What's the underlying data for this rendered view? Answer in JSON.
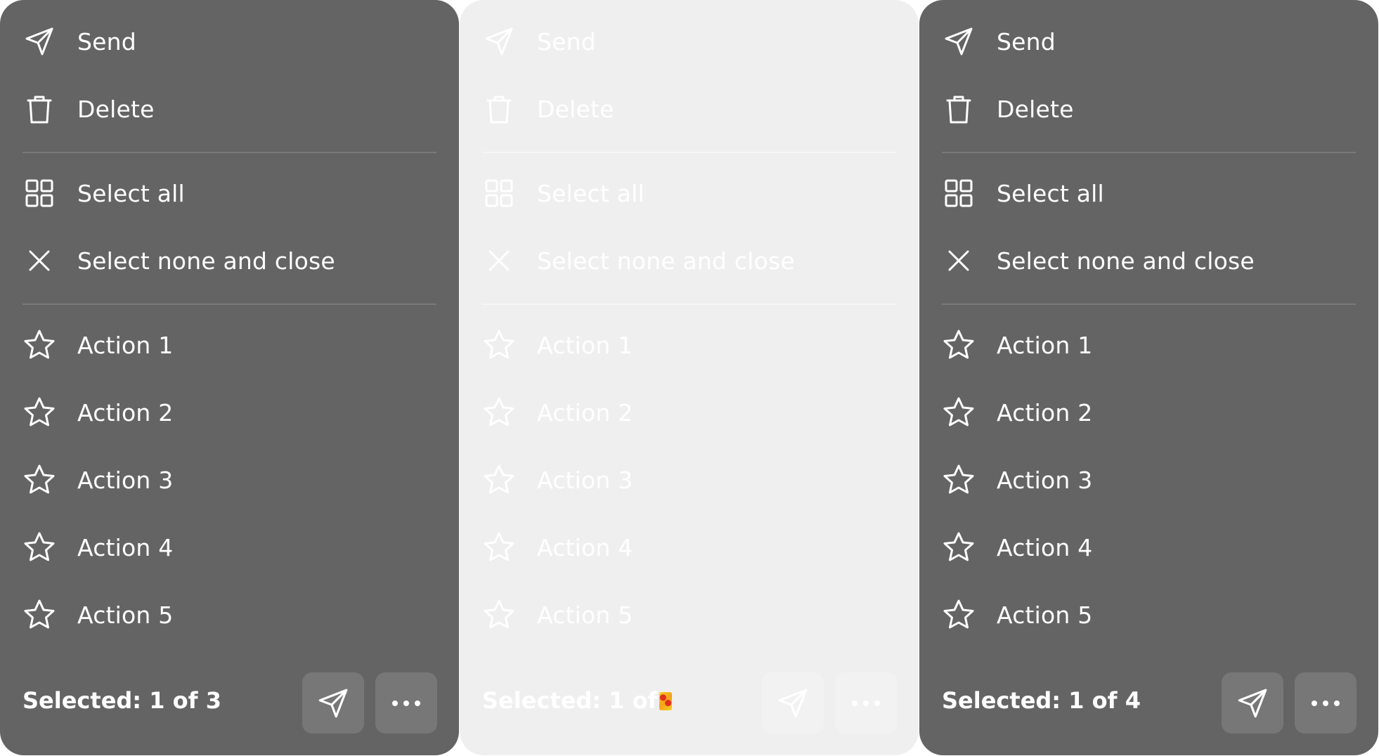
{
  "panels": [
    {
      "theme": "dark",
      "menu": {
        "send": "Send",
        "delete": "Delete",
        "select_all": "Select all",
        "select_none": "Select none and close",
        "actions": [
          "Action 1",
          "Action 2",
          "Action 3",
          "Action 4",
          "Action 5"
        ]
      },
      "footer": {
        "selected": "Selected: 1 of 3"
      }
    },
    {
      "theme": "light",
      "menu": {
        "send": "Send",
        "delete": "Delete",
        "select_all": "Select all",
        "select_none": "Select none and close",
        "actions": [
          "Action 1",
          "Action 2",
          "Action 3",
          "Action 4",
          "Action 5"
        ]
      },
      "footer": {
        "selected": "Selected: 1 of"
      }
    },
    {
      "theme": "dark",
      "menu": {
        "send": "Send",
        "delete": "Delete",
        "select_all": "Select all",
        "select_none": "Select none and close",
        "actions": [
          "Action 1",
          "Action 2",
          "Action 3",
          "Action 4",
          "Action 5"
        ]
      },
      "footer": {
        "selected": "Selected: 1 of 4"
      }
    }
  ],
  "icons": {
    "send": "send-icon",
    "delete": "trash-icon",
    "select_all": "grid-icon",
    "select_none": "close-icon",
    "action": "star-icon",
    "more": "more-horizontal-icon"
  },
  "colors": {
    "dark_panel": "#646464",
    "light_panel": "#efefef",
    "dark_button": "#777777",
    "text": "#ffffff"
  }
}
